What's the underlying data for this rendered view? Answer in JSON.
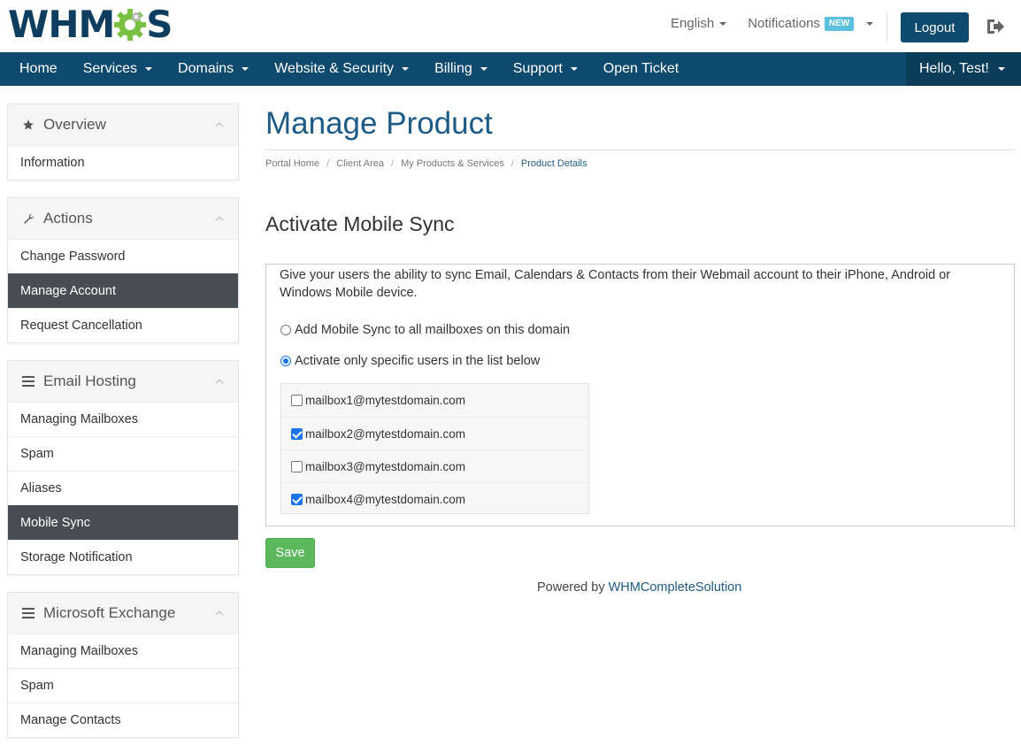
{
  "header": {
    "logo_text_left": "WHM",
    "logo_text_right": "S",
    "language": "English",
    "notifications": "Notifications",
    "notifications_badge": "NEW",
    "logout": "Logout"
  },
  "nav": {
    "items": [
      {
        "label": "Home",
        "dropdown": false
      },
      {
        "label": "Services",
        "dropdown": true
      },
      {
        "label": "Domains",
        "dropdown": true
      },
      {
        "label": "Website & Security",
        "dropdown": true
      },
      {
        "label": "Billing",
        "dropdown": true
      },
      {
        "label": "Support",
        "dropdown": true
      },
      {
        "label": "Open Ticket",
        "dropdown": false
      }
    ],
    "user": "Hello, Test!"
  },
  "sidebar": {
    "overview": {
      "title": "Overview",
      "items": [
        "Information"
      ]
    },
    "actions": {
      "title": "Actions",
      "items": [
        "Change Password",
        "Manage Account",
        "Request Cancellation"
      ]
    },
    "email_hosting": {
      "title": "Email Hosting",
      "items": [
        "Managing Mailboxes",
        "Spam",
        "Aliases",
        "Mobile Sync",
        "Storage Notification"
      ]
    },
    "exchange": {
      "title": "Microsoft Exchange",
      "items": [
        "Managing Mailboxes",
        "Spam",
        "Manage Contacts"
      ]
    }
  },
  "main": {
    "title": "Manage Product",
    "breadcrumb": [
      "Portal Home",
      "Client Area",
      "My Products & Services",
      "Product Details"
    ],
    "section_title": "Activate Mobile Sync",
    "description": "Give your users the ability to sync Email, Calendars & Contacts from their Webmail account to their iPhone, Android or Windows Mobile device.",
    "option_all": "Add Mobile Sync to all mailboxes on this domain",
    "option_specific": "Activate only specific users in the list below",
    "mailboxes": [
      {
        "email": "mailbox1@mytestdomain.com",
        "checked": false
      },
      {
        "email": "mailbox2@mytestdomain.com",
        "checked": true
      },
      {
        "email": "mailbox3@mytestdomain.com",
        "checked": false
      },
      {
        "email": "mailbox4@mytestdomain.com",
        "checked": true
      }
    ],
    "save": "Save",
    "powered_by": "Powered by",
    "powered_link": "WHMCompleteSolution"
  },
  "colors": {
    "brand": "#0e4a6e",
    "title": "#1d5a85",
    "active_item": "#474d52",
    "save": "#5cb85c",
    "badge": "#5bc0de",
    "logo_gear": "#7ac143"
  }
}
